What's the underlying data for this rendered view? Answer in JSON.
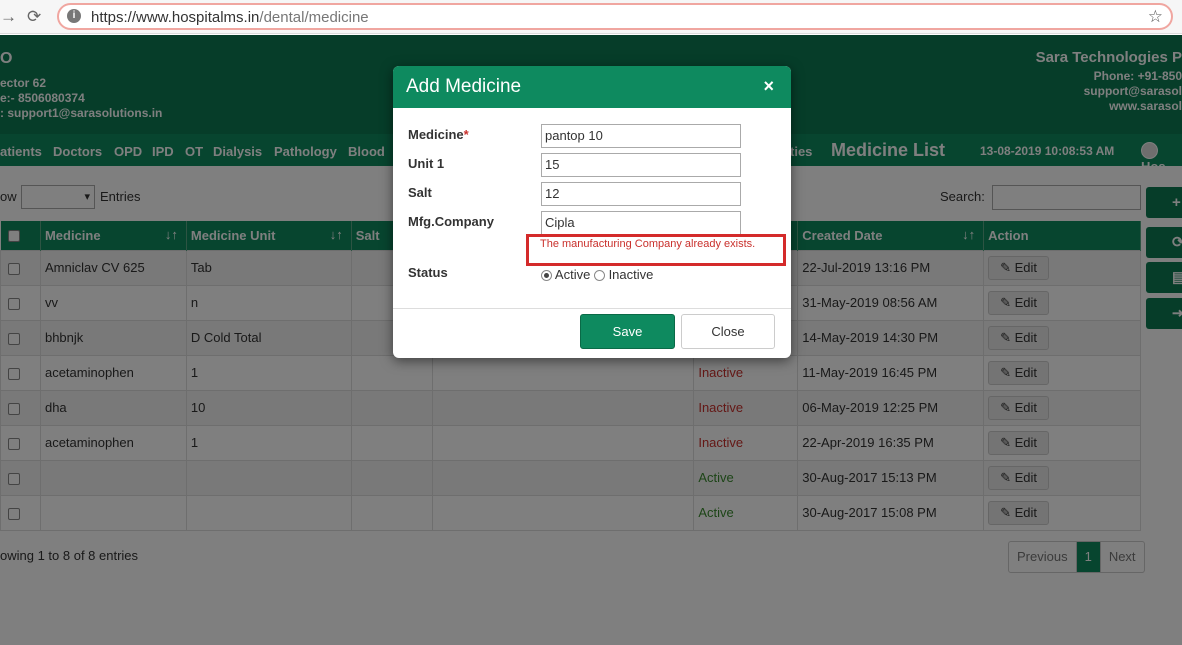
{
  "browser": {
    "url_host": "https://www.hospitalms.in",
    "url_path": "/dental/medicine"
  },
  "header": {
    "left_title": "O",
    "left_line1": "ector 62",
    "left_line2": "e:- 8506080374",
    "left_line3": ": support1@sarasolutions.in",
    "right_title": "Sara Technologies P",
    "right_line1": "Phone: +91-850",
    "right_line2": "support@sarasol",
    "right_line3": "www.sarasol"
  },
  "menu": {
    "items": [
      "atients",
      "Doctors",
      "OPD",
      "IPD",
      "OT",
      "Dialysis",
      "Pathology",
      "Blood"
    ],
    "partial": "ties",
    "page_title": "Medicine List",
    "datetime": "13-08-2019 10:08:53 AM",
    "user": "Hos"
  },
  "list": {
    "show_label": "ow",
    "entries_label": "Entries",
    "search_label": "Search:",
    "columns": [
      "Medicine",
      "Medicine Unit",
      "Salt",
      "",
      "",
      "Created Date",
      "Action"
    ],
    "rows": [
      {
        "medicine": "Amniclav CV 625",
        "unit": "Tab",
        "status": "",
        "created": "22-Jul-2019 13:16 PM"
      },
      {
        "medicine": "vv",
        "unit": "n",
        "status": "",
        "created": "31-May-2019 08:56 AM"
      },
      {
        "medicine": "bhbnjk",
        "unit": "D Cold Total",
        "status": "",
        "created": "14-May-2019 14:30 PM"
      },
      {
        "medicine": "acetaminophen",
        "unit": "1",
        "status": "Inactive",
        "created": "11-May-2019 16:45 PM"
      },
      {
        "medicine": "dha",
        "unit": "10",
        "status": "Inactive",
        "created": "06-May-2019 12:25 PM"
      },
      {
        "medicine": "acetaminophen",
        "unit": "1",
        "status": "Inactive",
        "created": "22-Apr-2019 16:35 PM"
      },
      {
        "medicine": "",
        "unit": "",
        "status": "Active",
        "created": "30-Aug-2017 15:13 PM"
      },
      {
        "medicine": "",
        "unit": "",
        "status": "Active",
        "created": "30-Aug-2017 15:08 PM"
      }
    ],
    "edit_label": "Edit",
    "showing_text": "owing 1 to 8 of 8 entries",
    "pager": {
      "previous": "Previous",
      "current": "1",
      "next": "Next"
    }
  },
  "modal": {
    "title": "Add Medicine",
    "close_symbol": "×",
    "medicine_label": "Medicine",
    "required_mark": "*",
    "medicine_value": "pantop 10",
    "unit_label": "Unit 1",
    "unit_value": "15",
    "salt_label": "Salt",
    "salt_value": "12",
    "company_label": "Mfg.Company",
    "company_value": "Cipla",
    "error_text": "The manufacturing Company already exists.",
    "status_label": "Status",
    "active_label": "Active",
    "inactive_label": "Inactive",
    "save_label": "Save",
    "close_label": "Close"
  },
  "colors": {
    "brand_green": "#0e8a5f",
    "error_red": "#c9302c"
  }
}
